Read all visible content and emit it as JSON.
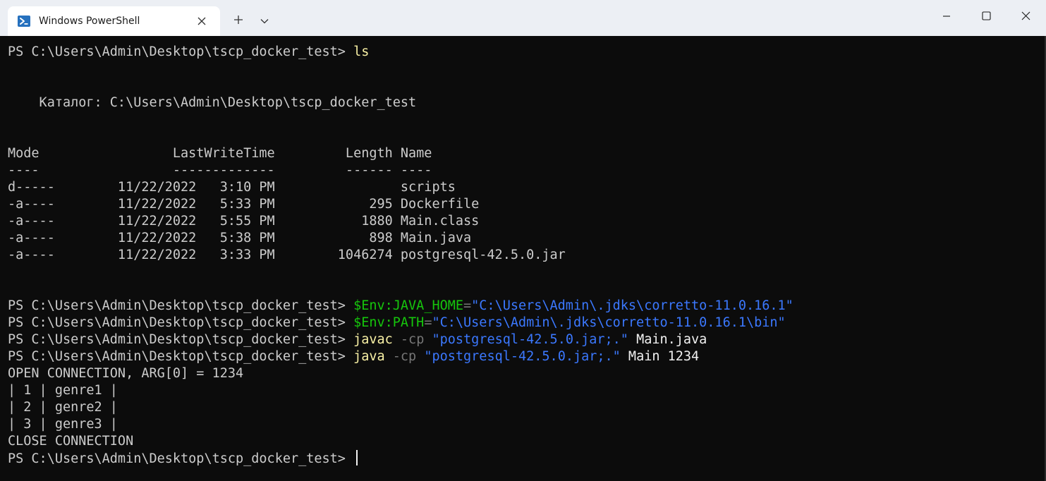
{
  "window": {
    "tab_title": "Windows PowerShell",
    "icons": {
      "tab": "powershell-icon",
      "tab_close": "close-icon",
      "new_tab": "plus-icon",
      "dropdown": "chevron-down-icon",
      "minimize": "minimize-icon",
      "maximize": "maximize-icon",
      "close": "close-icon"
    },
    "colors": {
      "titlebar": "#eceff4",
      "terminal_bg": "#0c0c0c",
      "text": "#cccccc",
      "command": "#f9f1a5",
      "variable": "#16c60c",
      "string": "#3b78ff",
      "parameter": "#767676"
    }
  },
  "terminal": {
    "prompt": "PS C:\\Users\\Admin\\Desktop\\tscp_docker_test> ",
    "cmd_ls": "ls",
    "dir_label": "    Каталог: C:\\Users\\Admin\\Desktop\\tscp_docker_test",
    "header": "Mode                 LastWriteTime         Length Name",
    "header_underline": "----                 -------------         ------ ----",
    "files": [
      "d-----        11/22/2022   3:10 PM                scripts",
      "-a----        11/22/2022   5:33 PM            295 Dockerfile",
      "-a----        11/22/2022   5:55 PM           1880 Main.class",
      "-a----        11/22/2022   5:38 PM            898 Main.java",
      "-a----        11/22/2022   3:33 PM        1046274 postgresql-42.5.0.jar"
    ],
    "cmd_java_home": {
      "var": "$Env:JAVA_HOME",
      "eq": "=",
      "value": "\"C:\\Users\\Admin\\.jdks\\corretto-11.0.16.1\""
    },
    "cmd_path": {
      "var": "$Env:PATH",
      "eq": "=",
      "value": "\"C:\\Users\\Admin\\.jdks\\corretto-11.0.16.1\\bin\""
    },
    "cmd_javac": {
      "cmd": "javac",
      "flag": " -cp ",
      "value": "\"postgresql-42.5.0.jar;.\"",
      "arg": " Main.java"
    },
    "cmd_java": {
      "cmd": "java",
      "flag": " -cp ",
      "value": "\"postgresql-42.5.0.jar;.\"",
      "arg": " Main ",
      "num": "1234"
    },
    "output": [
      "OPEN CONNECTION, ARG[0] = 1234",
      "| 1 | genre1 |",
      "| 2 | genre2 |",
      "| 3 | genre3 |",
      "CLOSE CONNECTION"
    ]
  }
}
